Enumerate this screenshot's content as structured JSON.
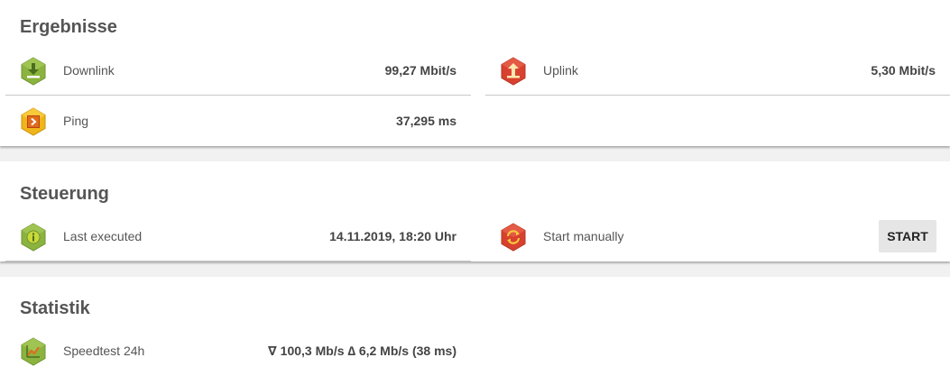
{
  "colors": {
    "green_icon": "#8bb33f",
    "red_icon": "#d8412f",
    "yellow_icon": "#f0b518",
    "card_background": "#ffffff",
    "page_background": "#f1f1f1"
  },
  "ergebnisse": {
    "title": "Ergebnisse",
    "downlink": {
      "label": "Downlink",
      "value": "99,27 Mbit/s",
      "icon": "download-icon"
    },
    "uplink": {
      "label": "Uplink",
      "value": "5,30 Mbit/s",
      "icon": "upload-icon"
    },
    "ping": {
      "label": "Ping",
      "value": "37,295 ms",
      "icon": "ping-icon"
    }
  },
  "steuerung": {
    "title": "Steuerung",
    "last_executed": {
      "label": "Last executed",
      "value": "14.11.2019, 18:20 Uhr",
      "icon": "info-icon"
    },
    "start_manually": {
      "label": "Start manually",
      "button": "START",
      "icon": "refresh-icon"
    }
  },
  "statistik": {
    "title": "Statistik",
    "speedtest": {
      "label": "Speedtest 24h",
      "value": "∇ 100,3 Mb/s ∆ 6,2 Mb/s (38 ms)",
      "icon": "chart-icon"
    }
  }
}
